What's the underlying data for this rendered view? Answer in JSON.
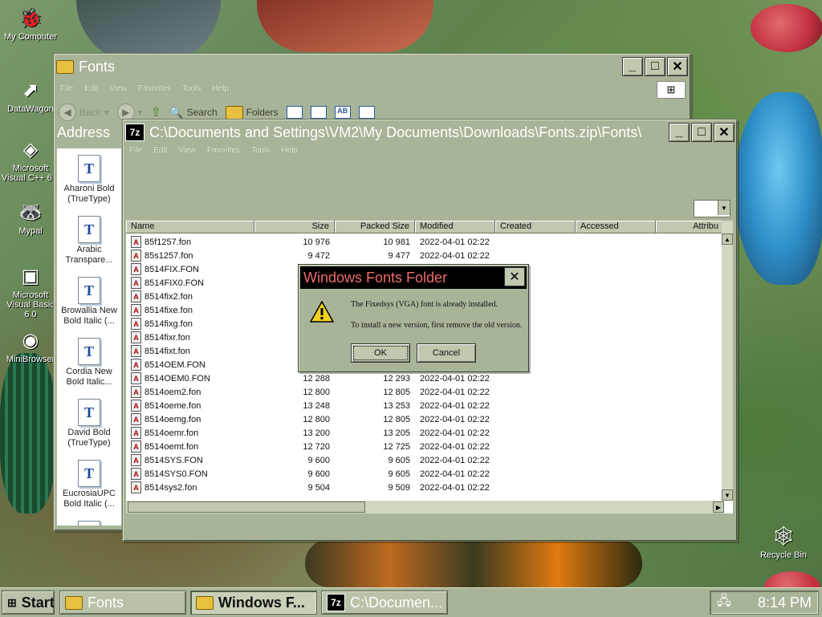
{
  "desktop": {
    "icons": [
      {
        "label": "My Computer"
      },
      {
        "label": "DataWagon"
      },
      {
        "label": "Microsoft Visual C++ 6.0"
      },
      {
        "label": "Mypal"
      },
      {
        "label": "Microsoft Visual Basic 6.0"
      },
      {
        "label": "MiniBrowser"
      },
      {
        "label": "Recycle Bin"
      }
    ]
  },
  "fonts_window": {
    "title": "Fonts",
    "menu": [
      "File",
      "Edit",
      "View",
      "Favorites",
      "Tools",
      "Help"
    ],
    "toolbar": {
      "back": "Back",
      "search": "Search",
      "folders": "Folders"
    },
    "address_label": "Address",
    "font_items": [
      {
        "name": "Aharoni Bold (TrueType)"
      },
      {
        "name": "Arabic Transpare..."
      },
      {
        "name": "Browallia New Bold Italic (..."
      },
      {
        "name": "Cordia New Bold Italic..."
      },
      {
        "name": "David Bold (TrueType)"
      },
      {
        "name": "EucrosiaUPC Bold Italic (..."
      }
    ]
  },
  "zip_window": {
    "title": "C:\\Documents and Settings\\VM2\\My Documents\\Downloads\\Fonts.zip\\Fonts\\",
    "menu": [
      "File",
      "Edit",
      "View",
      "Favorites",
      "Tools",
      "Help"
    ],
    "columns": [
      "Name",
      "Size",
      "Packed Size",
      "Modified",
      "Created",
      "Accessed",
      "Attribu"
    ],
    "rows": [
      {
        "name": "85f1257.fon",
        "size": "10 976",
        "packed": "10 981",
        "modified": "2022-04-01 02:22"
      },
      {
        "name": "85s1257.fon",
        "size": "9 472",
        "packed": "9 477",
        "modified": "2022-04-01 02:22"
      },
      {
        "name": "8514FIX.FON",
        "size": "",
        "packed": "",
        "modified": ""
      },
      {
        "name": "8514FIX0.FON",
        "size": "",
        "packed": "",
        "modified": ""
      },
      {
        "name": "8514fix2.fon",
        "size": "",
        "packed": "",
        "modified": ""
      },
      {
        "name": "8514fixe.fon",
        "size": "",
        "packed": "",
        "modified": ""
      },
      {
        "name": "8514fixg.fon",
        "size": "",
        "packed": "",
        "modified": ""
      },
      {
        "name": "8514fixr.fon",
        "size": "",
        "packed": "",
        "modified": ""
      },
      {
        "name": "8514fixt.fon",
        "size": "",
        "packed": "",
        "modified": ""
      },
      {
        "name": "8514OEM.FON",
        "size": "",
        "packed": "",
        "modified": ""
      },
      {
        "name": "8514OEM0.FON",
        "size": "12 288",
        "packed": "12 293",
        "modified": "2022-04-01 02:22"
      },
      {
        "name": "8514oem2.fon",
        "size": "12 800",
        "packed": "12 805",
        "modified": "2022-04-01 02:22"
      },
      {
        "name": "8514oeme.fon",
        "size": "13 248",
        "packed": "13 253",
        "modified": "2022-04-01 02:22"
      },
      {
        "name": "8514oemg.fon",
        "size": "12 800",
        "packed": "12 805",
        "modified": "2022-04-01 02:22"
      },
      {
        "name": "8514oemr.fon",
        "size": "13 200",
        "packed": "13 205",
        "modified": "2022-04-01 02:22"
      },
      {
        "name": "8514oemt.fon",
        "size": "12 720",
        "packed": "12 725",
        "modified": "2022-04-01 02:22"
      },
      {
        "name": "8514SYS.FON",
        "size": "9 600",
        "packed": "9 605",
        "modified": "2022-04-01 02:22"
      },
      {
        "name": "8514SYS0.FON",
        "size": "9 600",
        "packed": "9 605",
        "modified": "2022-04-01 02:22"
      },
      {
        "name": "8514sys2.fon",
        "size": "9 504",
        "packed": "9 509",
        "modified": "2022-04-01 02:22"
      }
    ]
  },
  "dialog": {
    "title": "Windows Fonts Folder",
    "message1": "The Fixedsys (VGA) font is already installed.",
    "message2": "To install a new version, first remove the old version.",
    "ok": "OK",
    "cancel": "Cancel"
  },
  "taskbar": {
    "start": "Start",
    "items": [
      {
        "label": "Fonts"
      },
      {
        "label": "Windows F..."
      },
      {
        "label": "C:\\Documen..."
      }
    ],
    "clock": "8:14 PM"
  }
}
